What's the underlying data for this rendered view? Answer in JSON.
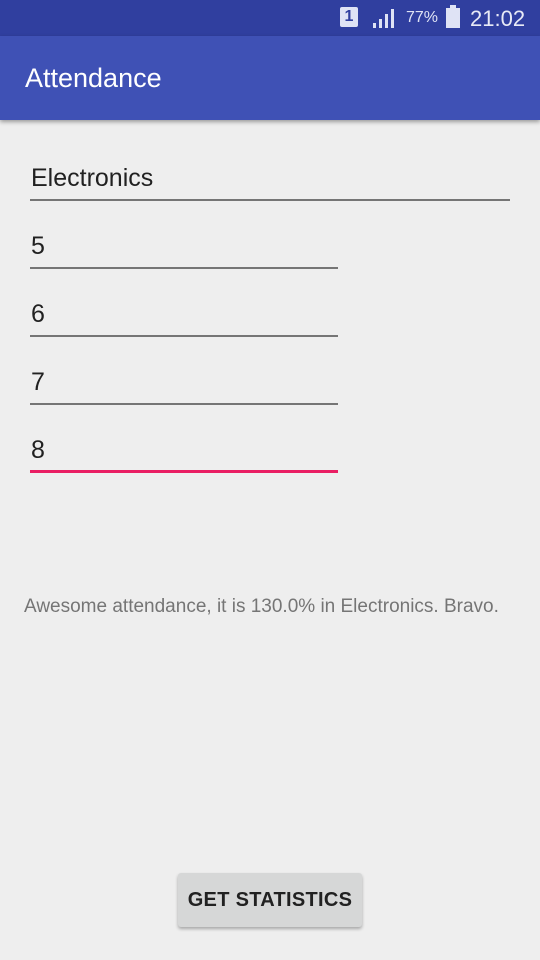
{
  "status_bar": {
    "sim_slot": "1",
    "battery_percent": "77%",
    "time": "21:02",
    "icons": [
      "sim-icon",
      "signal-icon",
      "battery-icon"
    ]
  },
  "app_bar": {
    "title": "Attendance",
    "color": "#3f51b5"
  },
  "form": {
    "subject": "Electronics",
    "fields": [
      "5",
      "6",
      "7",
      "8"
    ],
    "accent_color": "#e91e63"
  },
  "result": {
    "message": "Awesome attendance, it is 130.0% in Electronics. Bravo."
  },
  "actions": {
    "get_statistics_label": "GET STATISTICS"
  }
}
